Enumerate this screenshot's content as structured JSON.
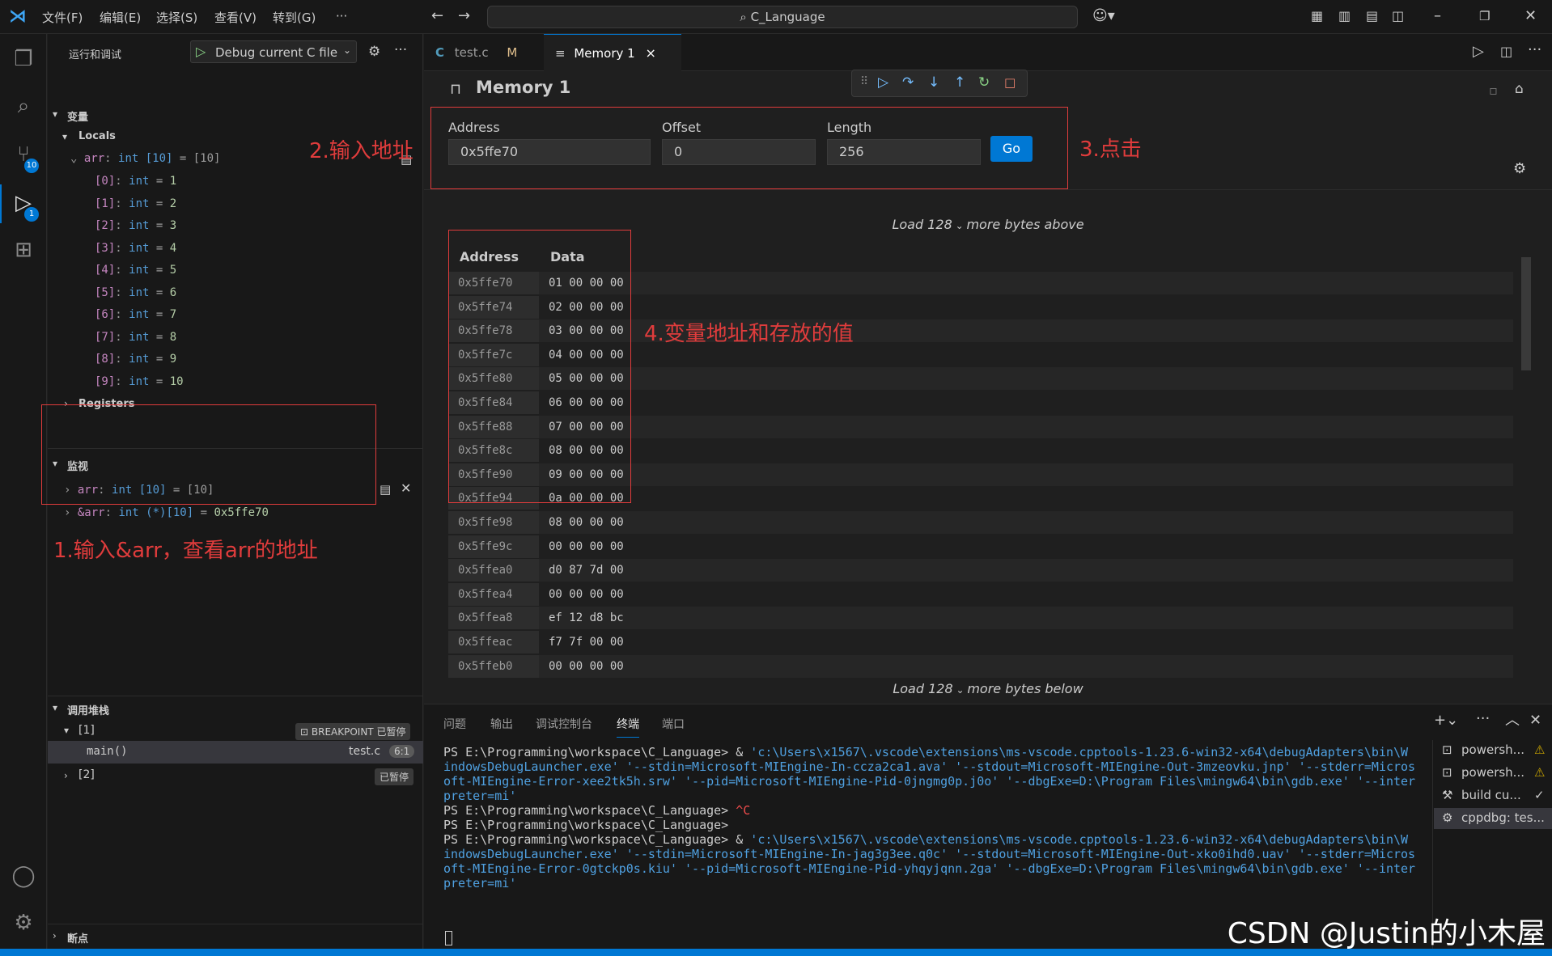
{
  "titlebar": {
    "menus": [
      "文件(F)",
      "编辑(E)",
      "选择(S)",
      "查看(V)",
      "转到(G)",
      "···"
    ],
    "search_text": "C_Language"
  },
  "activity": {
    "scm_badge": "10",
    "debug_badge": "1"
  },
  "sidebar": {
    "run_debug_title": "运行和调试",
    "debug_config": "Debug current C file",
    "variables_header": "变量",
    "locals_label": "Locals",
    "arr_row": {
      "name": "arr",
      "type": "int [10]",
      "value": "[10]"
    },
    "array_items": [
      {
        "index": "[0]",
        "type": "int",
        "value": "1"
      },
      {
        "index": "[1]",
        "type": "int",
        "value": "2"
      },
      {
        "index": "[2]",
        "type": "int",
        "value": "3"
      },
      {
        "index": "[3]",
        "type": "int",
        "value": "4"
      },
      {
        "index": "[4]",
        "type": "int",
        "value": "5"
      },
      {
        "index": "[5]",
        "type": "int",
        "value": "6"
      },
      {
        "index": "[6]",
        "type": "int",
        "value": "7"
      },
      {
        "index": "[7]",
        "type": "int",
        "value": "8"
      },
      {
        "index": "[8]",
        "type": "int",
        "value": "9"
      },
      {
        "index": "[9]",
        "type": "int",
        "value": "10"
      }
    ],
    "registers_label": "Registers",
    "watch_header": "监视",
    "watch": [
      {
        "name": "arr",
        "type": "int [10]",
        "value": "[10]"
      },
      {
        "name": "&arr",
        "type": "int (*)[10]",
        "value": "0x5ffe70"
      }
    ],
    "callstack_header": "调用堆栈",
    "thread1": "[1]",
    "thread1_status": "BREAKPOINT 已暂停",
    "frame_fn": "main()",
    "frame_file": "test.c",
    "frame_pos": "6:1",
    "thread2": "[2]",
    "thread2_status": "已暂停",
    "breakpoints_header": "断点"
  },
  "annotations": {
    "n1": "1.输入&arr，查看arr的地址",
    "n2": "2.输入地址",
    "n3": "3.点击",
    "n4": "4.变量地址和存放的值"
  },
  "tabs": [
    {
      "icon": "C",
      "label": "test.c",
      "flag": "M"
    },
    {
      "label": "Memory 1",
      "close": "×"
    }
  ],
  "memory": {
    "title": "Memory 1",
    "address_label": "Address",
    "address_value": "0x5ffe70",
    "offset_label": "Offset",
    "offset_value": "0",
    "length_label": "Length",
    "length_value": "256",
    "go_label": "Go",
    "load_above": [
      "Load",
      "128",
      "more bytes above"
    ],
    "load_below": [
      "Load",
      "128",
      "more bytes below"
    ],
    "col_address": "Address",
    "col_data": "Data",
    "rows": [
      {
        "addr": "0x5ffe70",
        "data": "01 00 00 00"
      },
      {
        "addr": "0x5ffe74",
        "data": "02 00 00 00"
      },
      {
        "addr": "0x5ffe78",
        "data": "03 00 00 00"
      },
      {
        "addr": "0x5ffe7c",
        "data": "04 00 00 00"
      },
      {
        "addr": "0x5ffe80",
        "data": "05 00 00 00"
      },
      {
        "addr": "0x5ffe84",
        "data": "06 00 00 00"
      },
      {
        "addr": "0x5ffe88",
        "data": "07 00 00 00"
      },
      {
        "addr": "0x5ffe8c",
        "data": "08 00 00 00"
      },
      {
        "addr": "0x5ffe90",
        "data": "09 00 00 00"
      },
      {
        "addr": "0x5ffe94",
        "data": "0a 00 00 00"
      },
      {
        "addr": "0x5ffe98",
        "data": "08 00 00 00"
      },
      {
        "addr": "0x5ffe9c",
        "data": "00 00 00 00"
      },
      {
        "addr": "0x5ffea0",
        "data": "d0 87 7d 00"
      },
      {
        "addr": "0x5ffea4",
        "data": "00 00 00 00"
      },
      {
        "addr": "0x5ffea8",
        "data": "ef 12 d8 bc"
      },
      {
        "addr": "0x5ffeac",
        "data": "f7 7f 00 00"
      },
      {
        "addr": "0x5ffeb0",
        "data": "00 00 00 00"
      }
    ]
  },
  "panel": {
    "tabs": [
      "问题",
      "输出",
      "调试控制台",
      "终端",
      "端口"
    ],
    "active_tab": "终端",
    "terminal_lines": [
      {
        "prompt": "PS E:\\Programming\\workspace\\C_Language>  & ",
        "rest": "'c:\\Users\\x1567\\.vscode\\extensions\\ms-vscode.cpptools-1.23.6-win32-x64\\debugAdapters\\bin\\W"
      },
      {
        "prompt": "",
        "rest": "indowsDebugLauncher.exe' '--stdin=Microsoft-MIEngine-In-ccza2ca1.ava' '--stdout=Microsoft-MIEngine-Out-3mzeovku.jnp' '--stderr=Micros"
      },
      {
        "prompt": "",
        "rest": "oft-MIEngine-Error-xee2tk5h.srw' '--pid=Microsoft-MIEngine-Pid-0jngmg0p.j0o' '--dbgExe=D:\\Program Files\\mingw64\\bin\\gdb.exe' '--inter"
      },
      {
        "prompt": "",
        "rest": "preter=mi'"
      },
      {
        "prompt": "PS E:\\Programming\\workspace\\C_Language> ",
        "rest": "^C"
      },
      {
        "prompt": "PS E:\\Programming\\workspace\\C_Language>",
        "rest": ""
      },
      {
        "prompt": "PS E:\\Programming\\workspace\\C_Language>  & ",
        "rest": "'c:\\Users\\x1567\\.vscode\\extensions\\ms-vscode.cpptools-1.23.6-win32-x64\\debugAdapters\\bin\\W"
      },
      {
        "prompt": "",
        "rest": "indowsDebugLauncher.exe' '--stdin=Microsoft-MIEngine-In-jag3g3ee.q0c' '--stdout=Microsoft-MIEngine-Out-xko0ihd0.uav' '--stderr=Micros"
      },
      {
        "prompt": "",
        "rest": "oft-MIEngine-Error-0gtckp0s.kiu' '--pid=Microsoft-MIEngine-Pid-yhqyjqnn.2ga' '--dbgExe=D:\\Program Files\\mingw64\\bin\\gdb.exe' '--inter"
      },
      {
        "prompt": "",
        "rest": "preter=mi'"
      }
    ],
    "side_items": [
      "powersh...",
      "powersh...",
      "build cu...",
      "cppdbg: tes..."
    ]
  },
  "watermark": "CSDN @Justin的小木屋"
}
